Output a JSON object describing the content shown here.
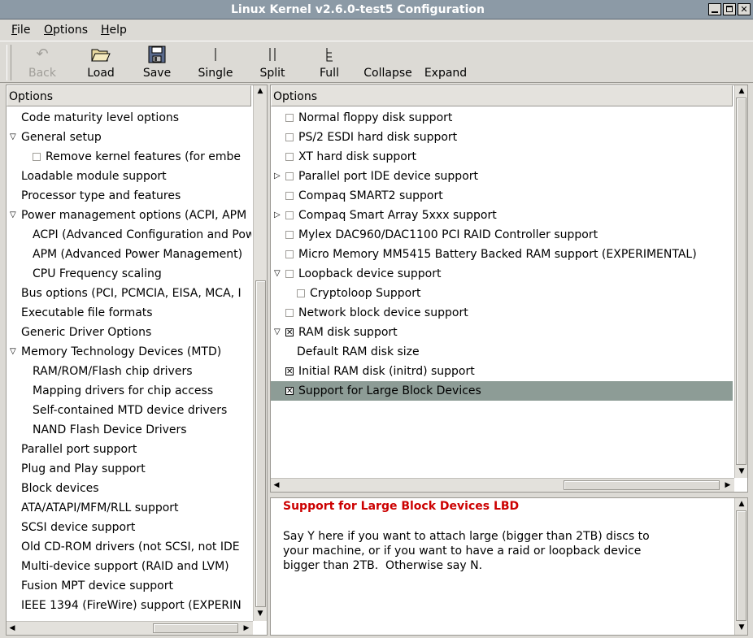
{
  "window": {
    "title": "Linux Kernel v2.6.0-test5 Configuration"
  },
  "menu": [
    {
      "pre": "",
      "u": "F",
      "post": "ile"
    },
    {
      "pre": "",
      "u": "O",
      "post": "ptions"
    },
    {
      "pre": "",
      "u": "H",
      "post": "elp"
    }
  ],
  "toolbar": {
    "back": "Back",
    "load": "Load",
    "save": "Save",
    "single": "Single",
    "split": "Split",
    "full": "Full",
    "collapse": "Collapse",
    "expand": "Expand"
  },
  "left": {
    "header": "Options",
    "items": [
      {
        "label": "Code maturity level options",
        "indent": 0,
        "tri": "",
        "cb": ""
      },
      {
        "label": "General setup",
        "indent": 0,
        "tri": "open",
        "cb": ""
      },
      {
        "label": "Remove kernel features (for embe",
        "indent": 1,
        "tri": "",
        "cb": "off"
      },
      {
        "label": "Loadable module support",
        "indent": 0,
        "tri": "",
        "cb": ""
      },
      {
        "label": "Processor type and features",
        "indent": 0,
        "tri": "",
        "cb": ""
      },
      {
        "label": "Power management options (ACPI, APM",
        "indent": 0,
        "tri": "open",
        "cb": ""
      },
      {
        "label": "ACPI (Advanced Configuration and Pow",
        "indent": 1,
        "tri": "",
        "cb": ""
      },
      {
        "label": "APM (Advanced Power Management) ",
        "indent": 1,
        "tri": "",
        "cb": ""
      },
      {
        "label": "CPU Frequency scaling",
        "indent": 1,
        "tri": "",
        "cb": ""
      },
      {
        "label": "Bus options (PCI, PCMCIA, EISA, MCA, I",
        "indent": 0,
        "tri": "",
        "cb": ""
      },
      {
        "label": "Executable file formats",
        "indent": 0,
        "tri": "",
        "cb": ""
      },
      {
        "label": "Generic Driver Options",
        "indent": 0,
        "tri": "",
        "cb": ""
      },
      {
        "label": "Memory Technology Devices (MTD)",
        "indent": 0,
        "tri": "open",
        "cb": ""
      },
      {
        "label": "RAM/ROM/Flash chip drivers",
        "indent": 1,
        "tri": "",
        "cb": ""
      },
      {
        "label": "Mapping drivers for chip access",
        "indent": 1,
        "tri": "",
        "cb": ""
      },
      {
        "label": "Self-contained MTD device drivers",
        "indent": 1,
        "tri": "",
        "cb": ""
      },
      {
        "label": "NAND Flash Device Drivers",
        "indent": 1,
        "tri": "",
        "cb": ""
      },
      {
        "label": "Parallel port support",
        "indent": 0,
        "tri": "",
        "cb": ""
      },
      {
        "label": "Plug and Play support",
        "indent": 0,
        "tri": "",
        "cb": ""
      },
      {
        "label": "Block devices",
        "indent": 0,
        "tri": "",
        "cb": ""
      },
      {
        "label": "ATA/ATAPI/MFM/RLL support",
        "indent": 0,
        "tri": "",
        "cb": ""
      },
      {
        "label": "SCSI device support",
        "indent": 0,
        "tri": "",
        "cb": ""
      },
      {
        "label": "Old CD-ROM drivers (not SCSI, not IDE",
        "indent": 0,
        "tri": "",
        "cb": ""
      },
      {
        "label": "Multi-device support (RAID and LVM)",
        "indent": 0,
        "tri": "",
        "cb": ""
      },
      {
        "label": "Fusion MPT device support",
        "indent": 0,
        "tri": "",
        "cb": ""
      },
      {
        "label": "IEEE 1394 (FireWire) support (EXPERIN",
        "indent": 0,
        "tri": "",
        "cb": ""
      }
    ]
  },
  "right": {
    "header": "Options",
    "items": [
      {
        "label": "Normal floppy disk support",
        "indent": 0,
        "tri": "",
        "cb": "off"
      },
      {
        "label": "PS/2 ESDI hard disk support",
        "indent": 0,
        "tri": "",
        "cb": "off"
      },
      {
        "label": "XT hard disk support",
        "indent": 0,
        "tri": "",
        "cb": "off"
      },
      {
        "label": "Parallel port IDE device support",
        "indent": 0,
        "tri": "closed",
        "cb": "off"
      },
      {
        "label": "Compaq SMART2 support",
        "indent": 0,
        "tri": "",
        "cb": "off"
      },
      {
        "label": "Compaq Smart Array 5xxx support",
        "indent": 0,
        "tri": "closed",
        "cb": "off"
      },
      {
        "label": "Mylex DAC960/DAC1100 PCI RAID Controller support",
        "indent": 0,
        "tri": "",
        "cb": "off"
      },
      {
        "label": "Micro Memory MM5415 Battery Backed RAM support (EXPERIMENTAL)",
        "indent": 0,
        "tri": "",
        "cb": "off"
      },
      {
        "label": "Loopback device support",
        "indent": 0,
        "tri": "open",
        "cb": "off"
      },
      {
        "label": "Cryptoloop Support",
        "indent": 1,
        "tri": "",
        "cb": "off"
      },
      {
        "label": "Network block device support",
        "indent": 0,
        "tri": "",
        "cb": "off"
      },
      {
        "label": "RAM disk support",
        "indent": 0,
        "tri": "open",
        "cb": "on"
      },
      {
        "label": "Default RAM disk size",
        "indent": 0,
        "tri": "",
        "cb": "none"
      },
      {
        "label": "Initial RAM disk (initrd) support",
        "indent": 0,
        "tri": "",
        "cb": "on"
      },
      {
        "label": "Support for Large Block Devices",
        "indent": 0,
        "tri": "",
        "cb": "on",
        "selected": true
      }
    ]
  },
  "help": {
    "title": "Support for Large Block Devices LBD",
    "text": "Say Y here if you want to attach large (bigger than 2TB) discs to\nyour machine, or if you want to have a raid or loopback device\nbigger than 2TB.  Otherwise say N."
  }
}
